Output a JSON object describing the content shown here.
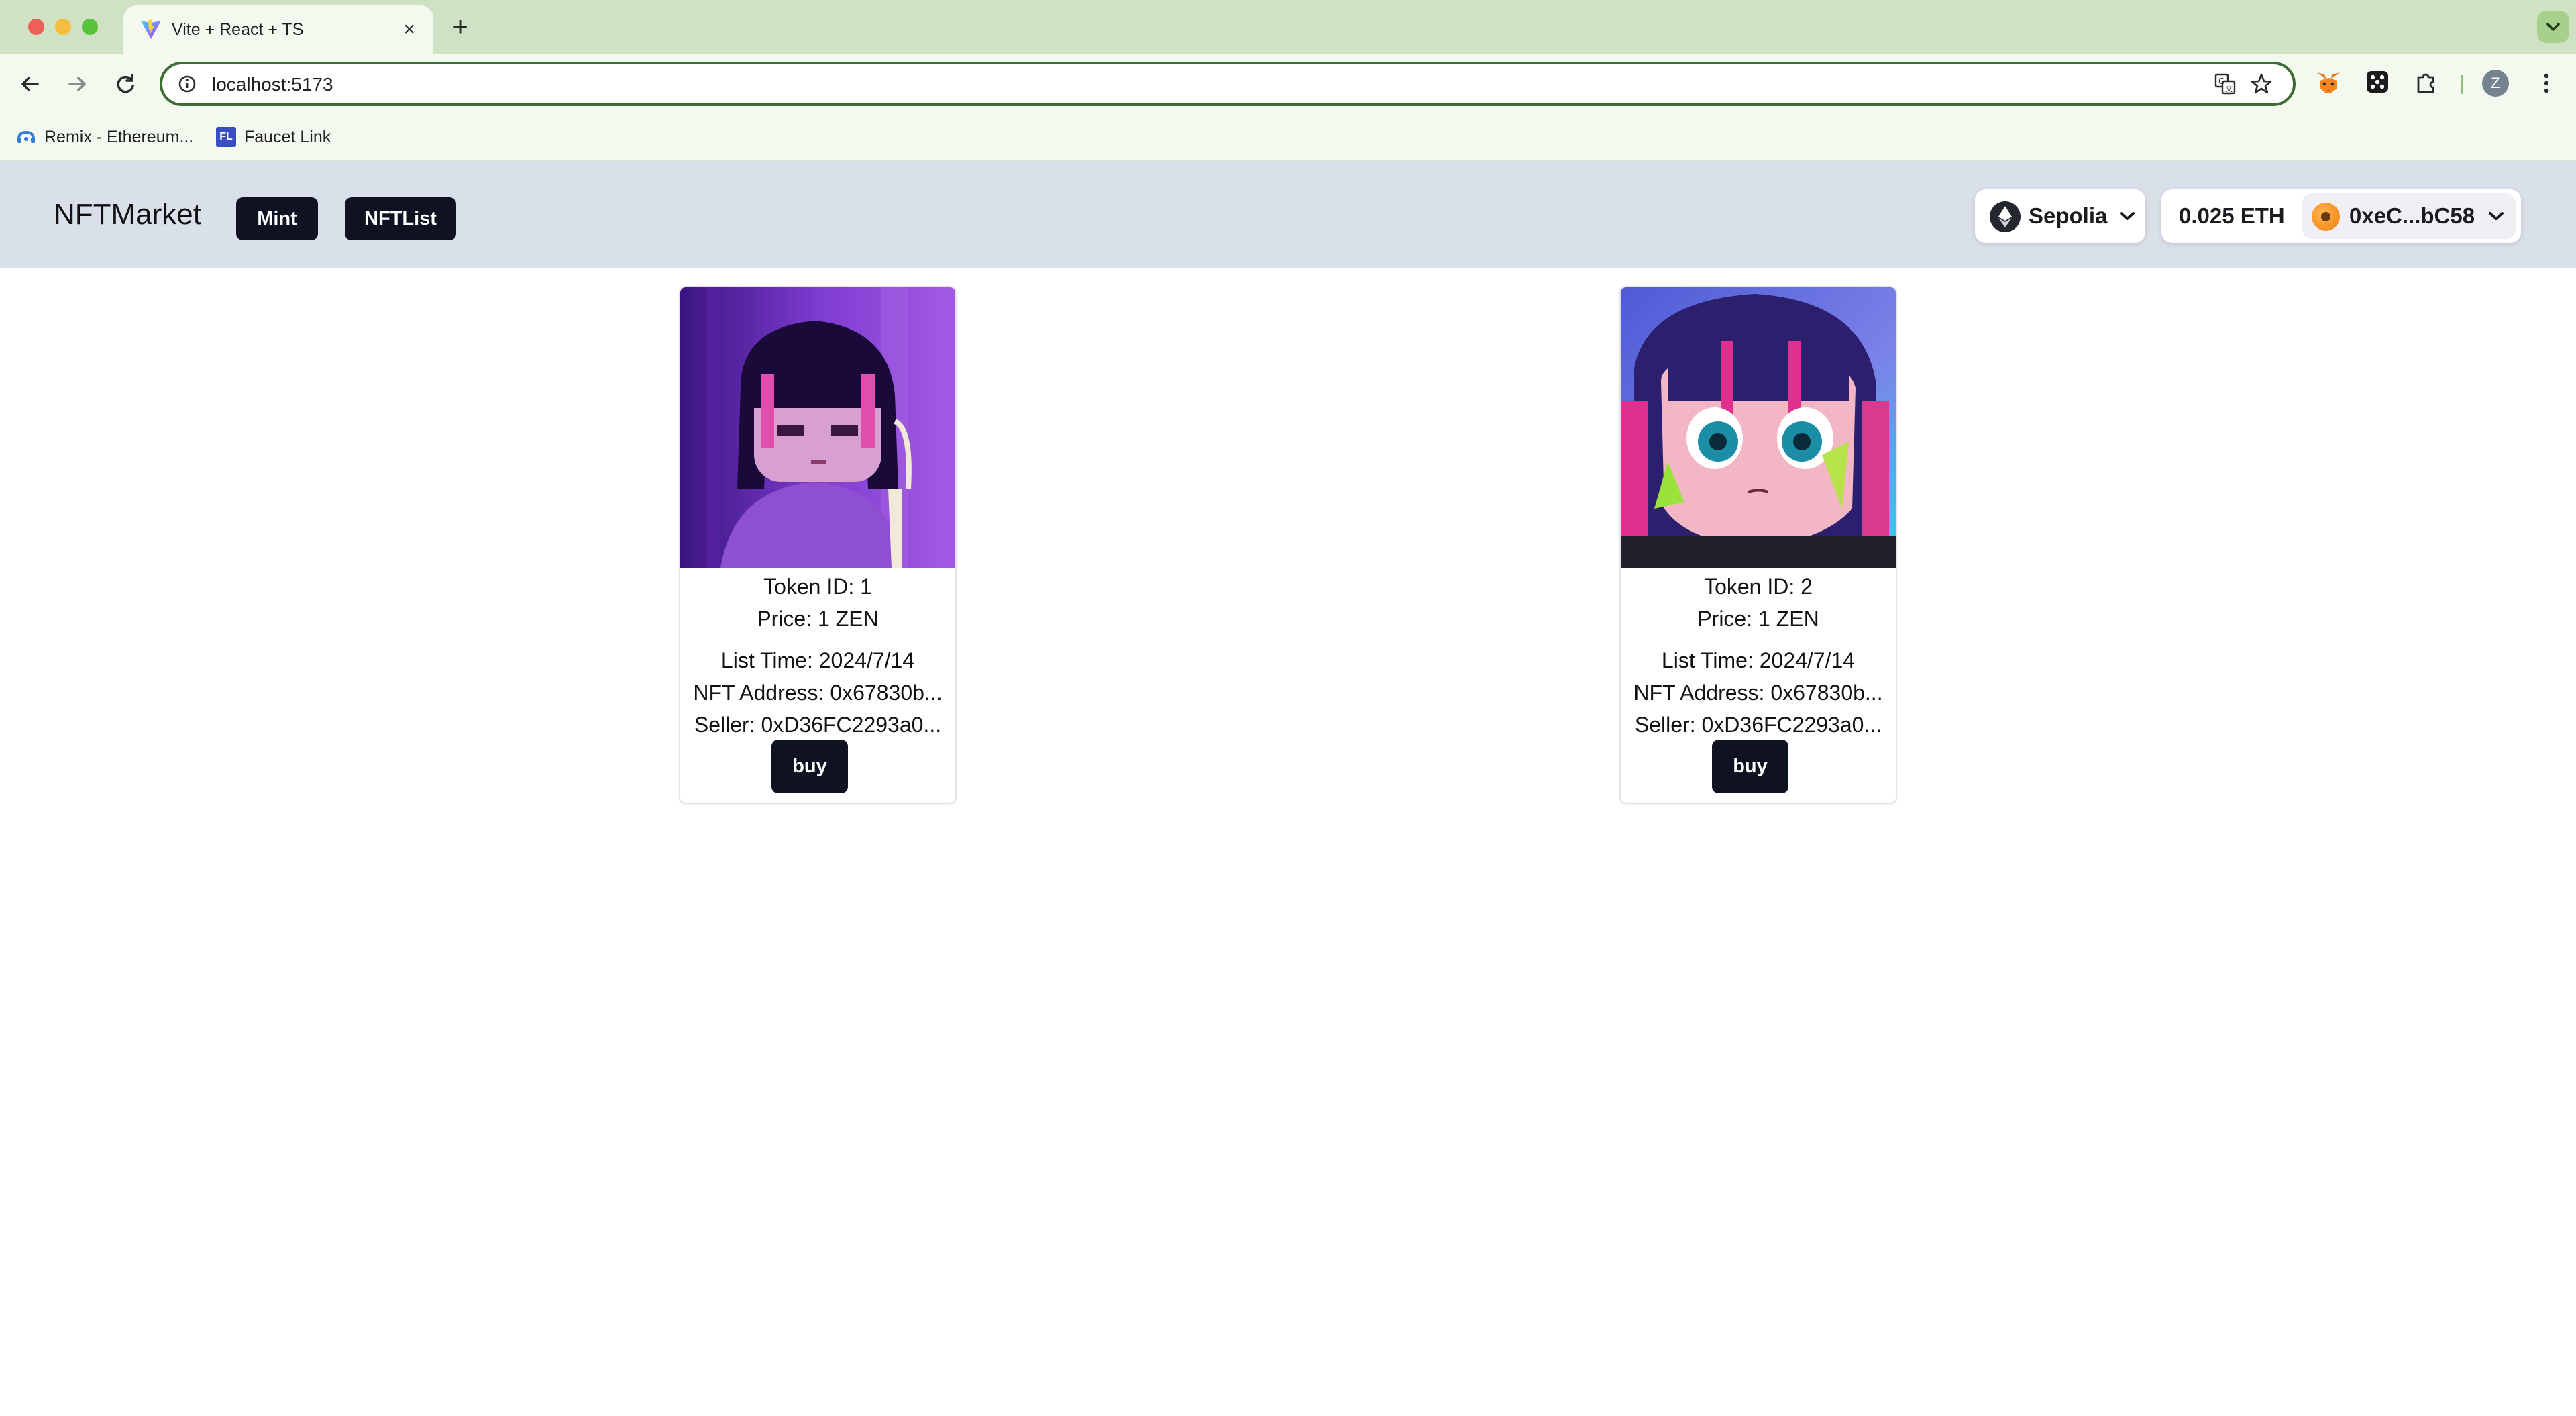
{
  "browser": {
    "tab_title": "Vite + React + TS",
    "url": "localhost:5173",
    "profile_initial": "Z",
    "bookmarks": [
      {
        "label": "Remix - Ethereum...",
        "icon": "remix-icon"
      },
      {
        "label": "Faucet Link",
        "icon": "fl-icon",
        "icon_text": "FL"
      }
    ]
  },
  "header": {
    "brand": "NFTMarket",
    "nav": {
      "mint": "Mint",
      "nftlist": "NFTList"
    },
    "network": "Sepolia",
    "balance": "0.025 ETH",
    "account": "0xeC...bC58"
  },
  "cards": [
    {
      "token_id": "Token ID: 1",
      "price": "Price: 1 ZEN",
      "list_time": "List Time: 2024/7/14",
      "nft_address": "NFT Address: 0x67830b...",
      "seller": "Seller: 0xD36FC2293a0...",
      "buy_label": "buy"
    },
    {
      "token_id": "Token ID: 2",
      "price": "Price: 1 ZEN",
      "list_time": "List Time: 2024/7/14",
      "nft_address": "NFT Address: 0x67830b...",
      "seller": "Seller: 0xD36FC2293a0...",
      "buy_label": "buy"
    }
  ],
  "colors": {
    "tabbar": "#cfe3c4",
    "toolbar": "#f4f9ef",
    "app_header": "#dae0ea",
    "button_dark": "#0f1220"
  }
}
